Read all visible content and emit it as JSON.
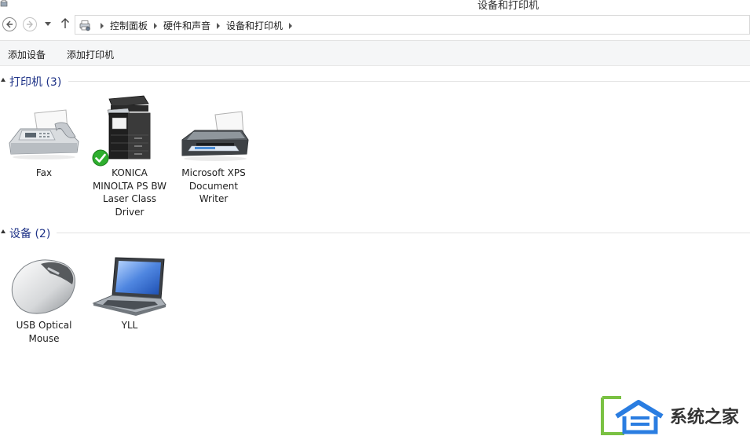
{
  "window": {
    "title": "设备和打印机"
  },
  "breadcrumb": [
    "控制面板",
    "硬件和声音",
    "设备和打印机"
  ],
  "commands": {
    "add_device": "添加设备",
    "add_printer": "添加打印机"
  },
  "groups": {
    "printers": {
      "title": "打印机 (3)",
      "items": [
        {
          "label": "Fax",
          "icon": "fax-icon"
        },
        {
          "label": "KONICA MINOLTA PS BW Laser Class Driver",
          "icon": "copier-printer-icon",
          "default": true
        },
        {
          "label": "Microsoft XPS Document Writer",
          "icon": "printer-icon"
        }
      ]
    },
    "devices": {
      "title": "设备 (2)",
      "items": [
        {
          "label": "USB Optical Mouse",
          "icon": "mouse-icon"
        },
        {
          "label": "YLL",
          "icon": "laptop-icon"
        }
      ]
    }
  },
  "watermark": {
    "text": "系统之家"
  },
  "colors": {
    "group_title": "#1e3287",
    "command_bar": "#f5f6f7",
    "default_check": "#2eae2e"
  }
}
